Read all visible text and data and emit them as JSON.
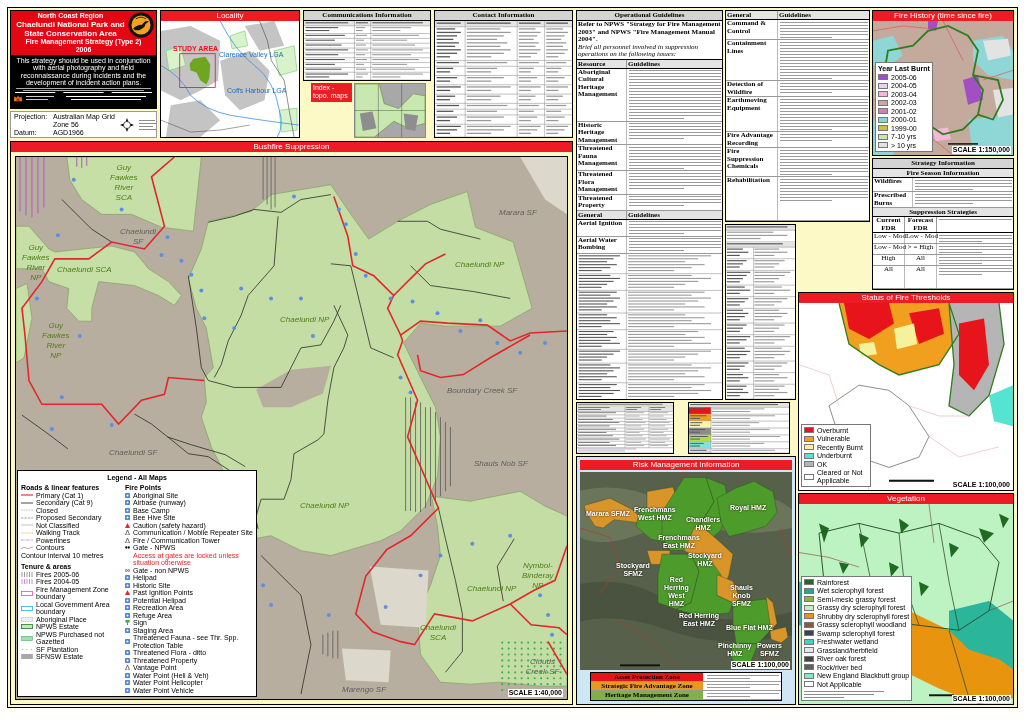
{
  "title_block": {
    "region": "North Coast Region",
    "title": "Chaelundi National Park and State Conservation Area",
    "subtitle": "Fire Management Strategy (Type 2)",
    "year": "2006",
    "notice": "This strategy should be used in conjunction with aerial photography and field reconnaissance during incidents and the development of incident action plans."
  },
  "projection": {
    "rows": [
      {
        "label": "Projection:",
        "value": "Australian Map Grid"
      },
      {
        "value": "Zone 56"
      },
      {
        "label": "Datum:",
        "value": "AGD1966"
      }
    ]
  },
  "locality": {
    "title": "Locality",
    "labels": [
      {
        "text": "STUDY AREA",
        "kind": "study_area"
      },
      {
        "text": "Clarence Valley LGA",
        "kind": "lga"
      },
      {
        "text": "Coffs Harbour LGA",
        "kind": "lga"
      }
    ]
  },
  "communications": {
    "title": "Communications Information"
  },
  "index_map": {
    "label": "Index - topo. maps"
  },
  "contacts": {
    "title": "Contact Information"
  },
  "operational_guidelines": {
    "title": "Operational Guidelines",
    "intro": "Refer to NPWS \"Strategy for Fire Management 2003\" and NPWS \"Fire Management Manual 2004\".",
    "brief": "Brief all personnel involved in suppression operations on the following issues:",
    "columns": [
      "Resource",
      "Guidelines"
    ],
    "rows": [
      "Aboriginal Cultural Heritage Management",
      "Historic Heritage Management",
      "Threatened Fauna Management",
      "Threatened Flora Management",
      "Threatened Property"
    ],
    "general_columns": [
      "General",
      "Guidelines"
    ],
    "general_rows": [
      "Aerial Ignition",
      "Aerial Water Bombing"
    ]
  },
  "general": {
    "columns": [
      "General",
      "Guidelines"
    ],
    "rows": [
      "Command & Control",
      "Containment Lines",
      "Detection of Wildfire",
      "Earthmoving Equipment",
      "Fire Advantage Recording",
      "Fire Suppression Chemicals",
      "Rehabilitation"
    ]
  },
  "fire_history": {
    "title": "Fire History (time since fire)",
    "legend_title": "Year Last Burnt",
    "legend": [
      {
        "label": "2005-06",
        "color": "#a24fc4"
      },
      {
        "label": "2004-05",
        "color": "#e6d3f2"
      },
      {
        "label": "2003-04",
        "color": "#f7b4d6"
      },
      {
        "label": "2002-03",
        "color": "#c4ab9d"
      },
      {
        "label": "2001-02",
        "color": "#c686b0"
      },
      {
        "label": "2000-01",
        "color": "#88d3d3"
      },
      {
        "label": "1999-00",
        "color": "#c9c043"
      },
      {
        "label": "7-10 yrs",
        "color": "#c8e6ab"
      },
      {
        "label": "> 10 yrs",
        "color": "#e3e3e3"
      }
    ],
    "scale": "SCALE 1:150,000"
  },
  "strategy": {
    "title": "Strategy Information",
    "season_title": "Fire Season Information",
    "season_rows": [
      "Wildfires",
      "Prescribed Burns"
    ],
    "suppression_title": "Suppression Strategies",
    "columns": [
      "Current FDR",
      "Forecast FDR"
    ],
    "rows": [
      {
        "current": "Low - Mod",
        "forecast": "Low - Mod"
      },
      {
        "current": "Low - Mod",
        "forecast": "> = High"
      },
      {
        "current": "High",
        "forecast": "All"
      },
      {
        "current": "All",
        "forecast": "All"
      }
    ]
  },
  "bushfire_suppression": {
    "title": "Bushfire Suppression",
    "labels": [
      {
        "text": "Guy Fawkes River SCA",
        "kind": "park"
      },
      {
        "text": "Marara SF",
        "kind": "forest"
      },
      {
        "text": "Guy Fawkes River NP",
        "kind": "park"
      },
      {
        "text": "Chaelundi SF",
        "kind": "forest"
      },
      {
        "text": "Chaelundi SCA",
        "kind": "park"
      },
      {
        "text": "Chaelundi NP",
        "kind": "park"
      },
      {
        "text": "Guy Fawkes River NP",
        "kind": "park"
      },
      {
        "text": "Chaelundi NP",
        "kind": "park"
      },
      {
        "text": "Boundary Creek SF",
        "kind": "forest"
      },
      {
        "text": "Chaelundi SF",
        "kind": "forest"
      },
      {
        "text": "Shauls Nob SF",
        "kind": "forest"
      },
      {
        "text": "Chaelundi NP",
        "kind": "park"
      },
      {
        "text": "Chaelundi NP",
        "kind": "park"
      },
      {
        "text": "Nymboi-Binderay NP",
        "kind": "park"
      },
      {
        "text": "Chaelundi SCA",
        "kind": "park"
      },
      {
        "text": "Clouds Creek SF",
        "kind": "forest"
      },
      {
        "text": "Marengo SF",
        "kind": "forest"
      }
    ],
    "scale": "SCALE 1:40,000"
  },
  "legend": {
    "title": "Legend - All Maps",
    "roads_title": "Roads & linear features",
    "roads": [
      {
        "label": "Primary (Cat 1)",
        "kind": "primary"
      },
      {
        "label": "Secondary (Cat 9)",
        "kind": "secondary"
      },
      {
        "label": "Closed",
        "kind": "closed"
      },
      {
        "label": "Proposed Secondary",
        "kind": "proposed"
      },
      {
        "label": "Not Classified",
        "kind": "unclassified"
      },
      {
        "label": "Walking Track",
        "kind": "walking"
      },
      {
        "label": "Powerlines",
        "kind": "powerline"
      },
      {
        "label": "Contours",
        "kind": "contour"
      }
    ],
    "contour_note": "Contour interval 10 metres",
    "tenure_title": "Tenure & areas",
    "tenure": [
      {
        "label": "Fires 2005-06",
        "kind": "hatch_gray"
      },
      {
        "label": "Fires 2004-05",
        "kind": "hatch_purple"
      },
      {
        "label": "Fire Management Zone boundary",
        "kind": "outline_pink"
      },
      {
        "label": "Local Government Area boundary",
        "kind": "outline_blue"
      },
      {
        "label": "Aboriginal Place",
        "kind": "dotted"
      },
      {
        "label": "NPWS Estate",
        "kind": "outline_green"
      },
      {
        "label": "NPWS Purchased not Gazetted",
        "kind": "fill_green"
      },
      {
        "label": "SF Plantation",
        "kind": "dots_green"
      },
      {
        "label": "SFNSW Estate",
        "kind": "fill_gray"
      }
    ],
    "points_title": "Fire Points",
    "points": [
      {
        "label": "Aboriginal Site",
        "kind": "symbol"
      },
      {
        "label": "Airbase (runway)",
        "kind": "symbol"
      },
      {
        "label": "Base Camp",
        "kind": "symbol"
      },
      {
        "label": "Bee Hive Site",
        "kind": "symbol"
      },
      {
        "label": "Caution (safety hazard)",
        "kind": "hazard"
      },
      {
        "label": "Communication / Mobile Repeater Site",
        "kind": "tower"
      },
      {
        "label": "Fire / Communication Tower",
        "kind": "tower"
      },
      {
        "label": "Gate - NPWS",
        "kind": "gate"
      },
      {
        "label": "Access at gates are locked unless situation otherwise",
        "kind": "note"
      },
      {
        "label": "Gate - non NPWS",
        "kind": "gate_open"
      },
      {
        "label": "Helipad",
        "kind": "symbol"
      },
      {
        "label": "Historic Site",
        "kind": "symbol"
      },
      {
        "label": "Past Ignition Points",
        "kind": "hazard"
      },
      {
        "label": "Potential Helipad",
        "kind": "symbol"
      },
      {
        "label": "Recreation Area",
        "kind": "symbol"
      },
      {
        "label": "Refuge Area",
        "kind": "symbol"
      },
      {
        "label": "Sign",
        "kind": "sign"
      },
      {
        "label": "Staging Area",
        "kind": "symbol"
      },
      {
        "label": "Threatened Fauna - see Thr. Spp. Protection Table",
        "kind": "symbol"
      },
      {
        "label": "Threatened Flora - ditto",
        "kind": "symbol"
      },
      {
        "label": "Threatened Property",
        "kind": "symbol"
      },
      {
        "label": "Vantage Point",
        "kind": "tower"
      },
      {
        "label": "Water Point (Heli & Veh)",
        "kind": "symbol"
      },
      {
        "label": "Water Point Helicopter",
        "kind": "symbol"
      },
      {
        "label": "Water Point Vehicle",
        "kind": "symbol"
      }
    ]
  },
  "fire_thresholds": {
    "title": "Status of Fire Thresholds",
    "legend": [
      {
        "label": "Overburnt",
        "color": "#e8141b"
      },
      {
        "label": "Vulnerable",
        "color": "#f0a01e"
      },
      {
        "label": "Recently Burnt",
        "color": "#f6f29c"
      },
      {
        "label": "Underburnt",
        "color": "#55e3d2"
      },
      {
        "label": "OK",
        "color": "#b5b5b5"
      },
      {
        "label": "Cleared or Not Applicable",
        "color": "#ffffff"
      }
    ],
    "scale": "SCALE 1:100,000"
  },
  "risk_management": {
    "title": "Risk Management Information",
    "labels": [
      "Marara SFMZ",
      "Frenchmans West HMZ",
      "Chandlers HMZ",
      "Royal HMZ",
      "Frenchmans East HMZ",
      "Stockyard SFMZ",
      "Stockyard HMZ",
      "Red Herring West HMZ",
      "Shauls Knob SFMZ",
      "Red Herring East HMZ",
      "Blue Flat HMZ",
      "Pinchinny HMZ",
      "Powers SFMZ"
    ],
    "scale": "SCALE 1:100,000",
    "zones": [
      {
        "name": "Asset Protection Zone",
        "color": "#e8141b"
      },
      {
        "name": "Strategic Fire Advantage Zone",
        "color": "#e69a1e"
      },
      {
        "name": "Heritage Management Zone",
        "color": "#7cb342"
      }
    ]
  },
  "vegetation": {
    "title": "Vegetation",
    "legend": [
      {
        "label": "Rainforest",
        "color": "#1f6b22"
      },
      {
        "label": "Wet sclerophyll forest",
        "color": "#26a98a"
      },
      {
        "label": "Semi-mesic grassy forest",
        "color": "#8db43e"
      },
      {
        "label": "Grassy dry sclerophyll forest",
        "color": "#bff2c1"
      },
      {
        "label": "Shrubby dry sclerophyll forest",
        "color": "#e8940e"
      },
      {
        "label": "Grassy sclerophyll woodland",
        "color": "#8a5a3a"
      },
      {
        "label": "Swamp sclerophyll forest",
        "color": "#3d3f5c"
      },
      {
        "label": "Freshwater wetland",
        "color": "#3fd3bf"
      },
      {
        "label": "Grassland/herbfield",
        "color": "#e6e6e6"
      },
      {
        "label": "River oak forest",
        "color": "#444444"
      },
      {
        "label": "Rock/river bed",
        "color": "#5f5f5f"
      },
      {
        "label": "New England Blackbutt group",
        "color": "#84e8c2"
      },
      {
        "label": "Not Applicable",
        "color": "#ffffff"
      }
    ],
    "scale": "SCALE 1:100,000"
  }
}
